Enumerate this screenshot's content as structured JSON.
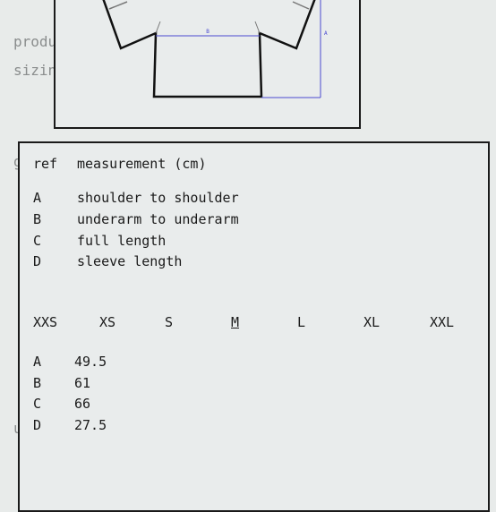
{
  "background_text": [
    "produ",
    "sizin",
    "g",
    "u"
  ],
  "diagram": {
    "label_a": "A",
    "label_b": "B",
    "line_color": "#4a4ad0"
  },
  "table": {
    "header": {
      "ref": "ref",
      "measurement": "measurement (cm)"
    },
    "refs": [
      {
        "ref": "A",
        "label": "shoulder to shoulder"
      },
      {
        "ref": "B",
        "label": "underarm to underarm"
      },
      {
        "ref": "C",
        "label": "full length"
      },
      {
        "ref": "D",
        "label": "sleeve length"
      }
    ],
    "sizes": [
      "XXS",
      "XS",
      "S",
      "M",
      "L",
      "XL",
      "XXL"
    ],
    "selected_size": "M",
    "values": [
      {
        "ref": "A",
        "value": "49.5"
      },
      {
        "ref": "B",
        "value": "61"
      },
      {
        "ref": "C",
        "value": "66"
      },
      {
        "ref": "D",
        "value": "27.5"
      }
    ]
  }
}
